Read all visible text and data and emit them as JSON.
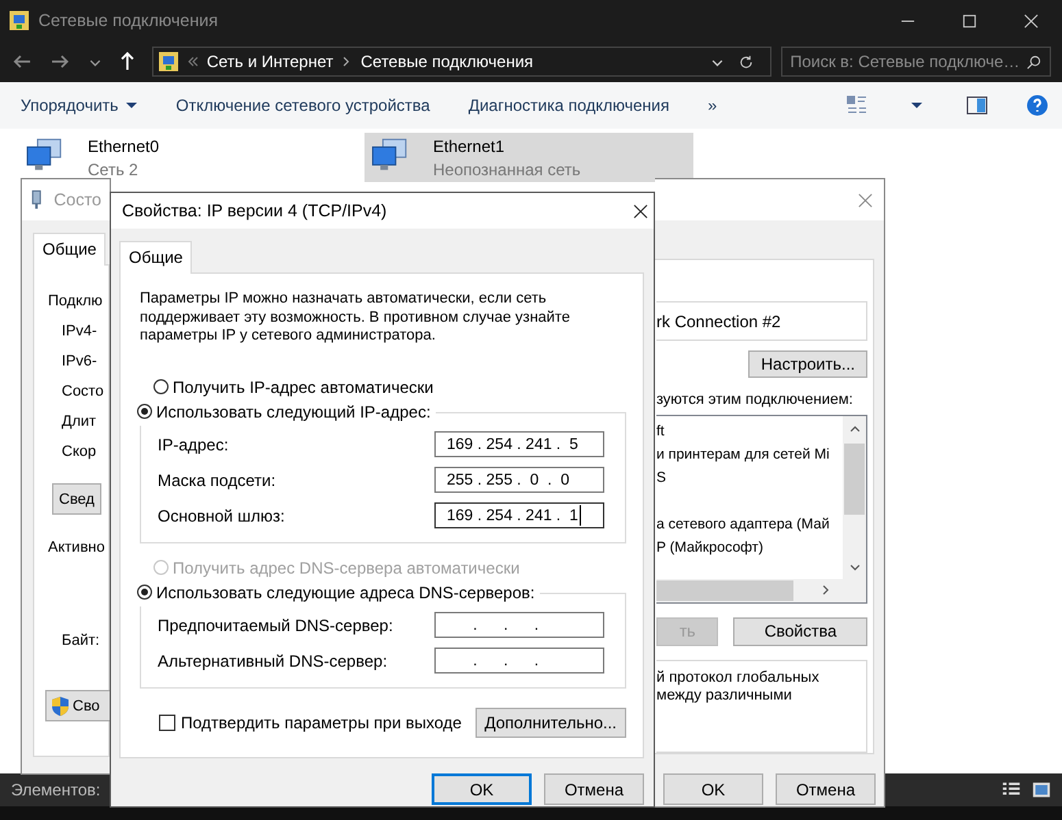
{
  "explorer": {
    "title": "Сетевые подключения",
    "breadcrumbs": [
      "Сеть и Интернет",
      "Сетевые подключения"
    ],
    "search": {
      "placeholder": "Поиск в: Сетевые подключе…"
    },
    "toolbar": [
      {
        "label": "Упорядочить",
        "kind": "menu"
      },
      {
        "label": "Отключение сетевого устройства",
        "kind": "command"
      },
      {
        "label": "Диагностика подключения",
        "kind": "command"
      },
      {
        "label": "»",
        "kind": "overflow"
      }
    ],
    "items": [
      {
        "name": "Ethernet0",
        "network": "Сеть 2",
        "selected": false
      },
      {
        "name": "Ethernet1",
        "network": "Неопознанная сеть",
        "selected": true
      }
    ],
    "status_bar": "Элементов:"
  },
  "status_window": {
    "title": "Состо",
    "tabs": [
      {
        "label": "Общие",
        "selected": true
      }
    ],
    "lines": [
      "Подклю",
      "IPv4-",
      "IPv6-",
      "Состо",
      "Длит",
      "Скор"
    ],
    "details_button": "Свед",
    "activity_label": "Активно",
    "bytes_label": "Байт:",
    "properties_button": "Сво"
  },
  "properties_window": {
    "adapter": "rk Connection #2",
    "configure_button": "Настроить...",
    "components_label": "зуются этим подключением:",
    "components": [
      {
        "text": "ft",
        "gap_before": false
      },
      {
        "text": "и принтерам для сетей Mi",
        "gap_before": false
      },
      {
        "text": "S",
        "gap_before": false
      },
      {
        "text": "а сетевого адаптера (Май",
        "gap_before": true
      },
      {
        "text": "P (Майкрософт)",
        "gap_before": false
      }
    ],
    "buttons": [
      {
        "label": "ть",
        "disabled": true
      },
      {
        "label": "Свойства",
        "disabled": false
      }
    ],
    "description": "й протокол глобальных\nмежду различными",
    "dialog_buttons": [
      "OK",
      "Отмена"
    ]
  },
  "ipv4_dialog": {
    "title": "Свойства: IP версии 4 (TCP/IPv4)",
    "tabs": [
      {
        "label": "Общие",
        "selected": true
      }
    ],
    "intro": "Параметры IP можно назначать автоматически, если сеть поддерживает эту возможность. В противном случае узнайте параметры IP у сетевого администратора.",
    "ip_modes": [
      {
        "label": "Получить IP-адрес автоматически",
        "selected": false,
        "disabled": false
      },
      {
        "label": "Использовать следующий IP-адрес:",
        "selected": true,
        "disabled": false
      }
    ],
    "ip_fields": [
      {
        "label": "IP-адрес:",
        "value": "169 . 254 . 241 .  5",
        "focused": false
      },
      {
        "label": "Маска подсети:",
        "value": "255 . 255 .  0  .  0",
        "focused": false
      },
      {
        "label": "Основной шлюз:",
        "value": "169 . 254 . 241 .  1",
        "focused": true
      }
    ],
    "dns_modes": [
      {
        "label": "Получить адрес DNS-сервера автоматически",
        "selected": false,
        "disabled": true
      },
      {
        "label": "Использовать следующие адреса DNS-серверов:",
        "selected": true,
        "disabled": false
      }
    ],
    "dns_fields": [
      {
        "label": "Предпочитаемый DNS-сервер:",
        "value": "      .      .      .",
        "focused": false
      },
      {
        "label": "Альтернативный DNS-сервер:",
        "value": "      .      .      .",
        "focused": false
      }
    ],
    "confirm": {
      "label": "Подтвердить параметры при выходе",
      "checked": false
    },
    "advanced_button": "Дополнительно...",
    "buttons": [
      {
        "label": "OK",
        "kind": "default"
      },
      {
        "label": "Отмена",
        "kind": "normal"
      }
    ]
  }
}
